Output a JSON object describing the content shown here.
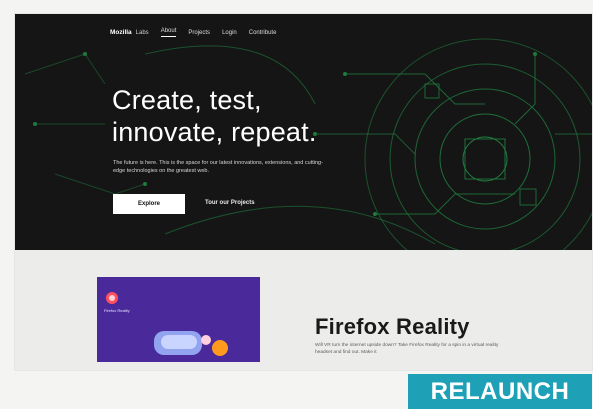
{
  "nav": {
    "brand": "Mozilla",
    "brand_sub": "Labs",
    "links": [
      "About",
      "Projects",
      "Login",
      "Contribute"
    ]
  },
  "hero": {
    "headline_line1": "Create, test,",
    "headline_line2": "innovate, repeat.",
    "subtext": "The future is here. This is the space for our latest innovations, extensions, and cutting-edge technologies on the greatest web.",
    "primary_button": "Explore",
    "secondary_link": "Tour our Projects"
  },
  "product": {
    "card_label": "Firefox Reality",
    "title": "Firefox Reality",
    "description": "Will VR turn the internet upside down? Take Firefox Reality for a spin in a virtual reality headset and find out. Make it"
  },
  "badge": {
    "text": "RELAUNCH"
  },
  "colors": {
    "hero_bg": "#151515",
    "circuit_green": "#1f7a3e",
    "badge_bg": "#1ea0b7",
    "card_purple": "#4a2a9a"
  }
}
